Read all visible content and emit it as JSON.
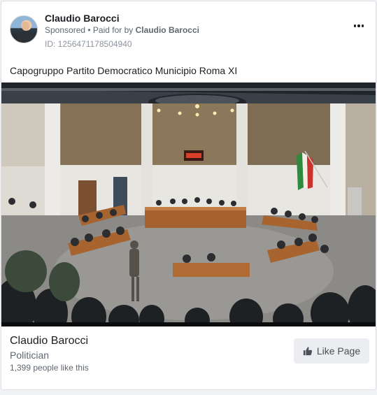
{
  "post": {
    "author": "Claudio Barocci",
    "sponsored_label": "Sponsored",
    "separator": " • ",
    "paid_for_prefix": "Paid for by ",
    "paid_for_name": "Claudio Barocci",
    "id_line": "ID: 1256471178504940",
    "message": "Capogruppo Partito Democratico Municipio Roma XI",
    "more_icon": "more-horizontal-icon"
  },
  "page": {
    "name": "Claudio Barocci",
    "category": "Politician",
    "likes": "1,399 people like this",
    "like_button": "Like Page",
    "like_icon": "thumbs-up-icon"
  },
  "colors": {
    "text_primary": "#1c1e21",
    "text_secondary": "#606770",
    "button_bg": "#ebedf0"
  }
}
